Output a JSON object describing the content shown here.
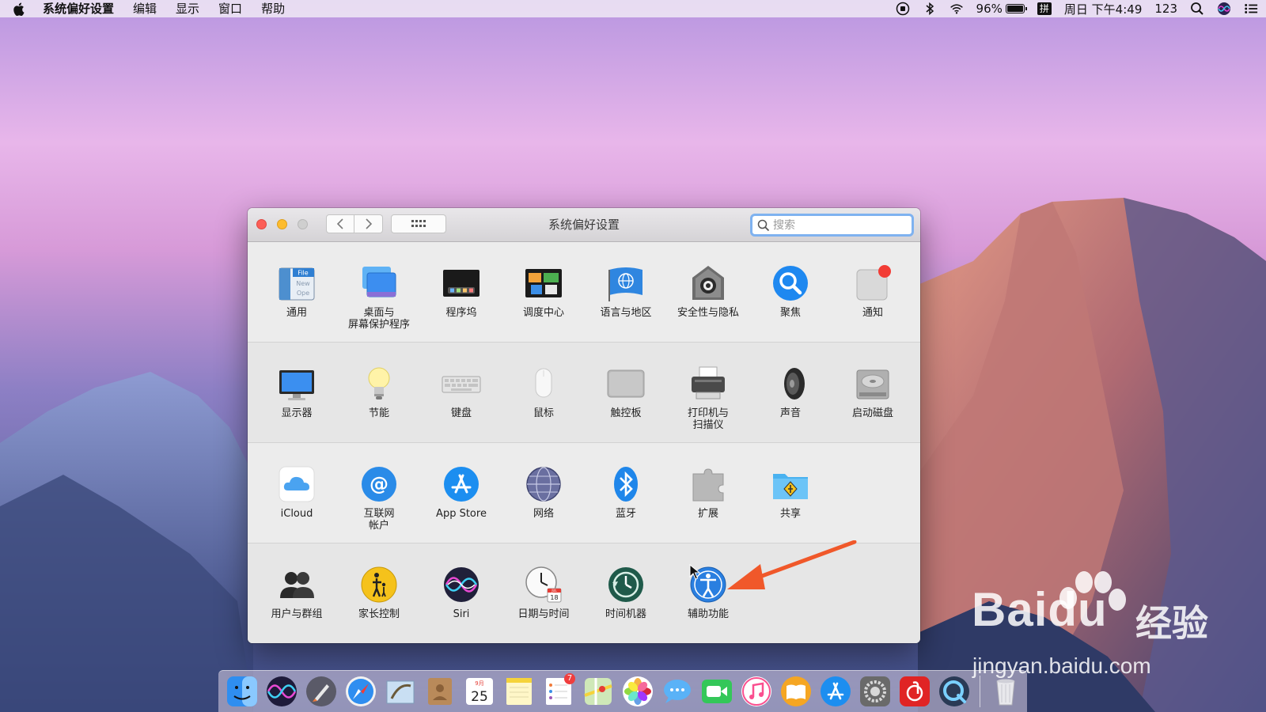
{
  "menubar": {
    "app_name": "系统偏好设置",
    "menus": [
      "编辑",
      "显示",
      "窗口",
      "帮助"
    ],
    "battery_percent": "96%",
    "battery_level": 0.96,
    "input_method": "拼",
    "datetime": "周日 下午4:49",
    "input_mode": "123"
  },
  "window": {
    "title": "系统偏好设置",
    "search": {
      "placeholder": "搜索",
      "value": ""
    }
  },
  "preferences": {
    "row1": [
      {
        "label": "通用",
        "icon": "general-icon",
        "icon_text": "File\nNew\nOpe"
      },
      {
        "label": "桌面与\n屏幕保护程序",
        "icon": "desktop-icon"
      },
      {
        "label": "程序坞",
        "icon": "dock-icon"
      },
      {
        "label": "调度中心",
        "icon": "mission-control-icon"
      },
      {
        "label": "语言与地区",
        "icon": "language-region-icon"
      },
      {
        "label": "安全性与隐私",
        "icon": "security-privacy-icon"
      },
      {
        "label": "聚焦",
        "icon": "spotlight-icon"
      },
      {
        "label": "通知",
        "icon": "notifications-icon"
      }
    ],
    "row2": [
      {
        "label": "显示器",
        "icon": "displays-icon"
      },
      {
        "label": "节能",
        "icon": "energy-saver-icon"
      },
      {
        "label": "键盘",
        "icon": "keyboard-icon"
      },
      {
        "label": "鼠标",
        "icon": "mouse-icon"
      },
      {
        "label": "触控板",
        "icon": "trackpad-icon"
      },
      {
        "label": "打印机与\n扫描仪",
        "icon": "printers-scanners-icon"
      },
      {
        "label": "声音",
        "icon": "sound-icon"
      },
      {
        "label": "启动磁盘",
        "icon": "startup-disk-icon"
      }
    ],
    "row3": [
      {
        "label": "iCloud",
        "icon": "icloud-icon"
      },
      {
        "label": "互联网\n帐户",
        "icon": "internet-accounts-icon"
      },
      {
        "label": "App Store",
        "icon": "app-store-icon"
      },
      {
        "label": "网络",
        "icon": "network-icon"
      },
      {
        "label": "蓝牙",
        "icon": "bluetooth-icon"
      },
      {
        "label": "扩展",
        "icon": "extensions-icon"
      },
      {
        "label": "共享",
        "icon": "sharing-icon"
      }
    ],
    "row4": [
      {
        "label": "用户与群组",
        "icon": "users-groups-icon"
      },
      {
        "label": "家长控制",
        "icon": "parental-controls-icon"
      },
      {
        "label": "Siri",
        "icon": "siri-icon"
      },
      {
        "label": "日期与时间",
        "icon": "date-time-icon",
        "icon_text": "JUL\n18"
      },
      {
        "label": "时间机器",
        "icon": "time-machine-icon"
      },
      {
        "label": "辅助功能",
        "icon": "accessibility-icon"
      }
    ]
  },
  "dock": {
    "calendar_month": "9月",
    "calendar_day": "25",
    "reminders_badge": "7"
  },
  "watermark": {
    "brand": "Baidu",
    "cn": "经验",
    "url": "jingyan.baidu.com"
  },
  "colors": {
    "close": "#fc5e57",
    "minimize": "#fdbc2e",
    "search_focus": "#7fb2f0",
    "annotation_arrow": "#f0582a"
  }
}
